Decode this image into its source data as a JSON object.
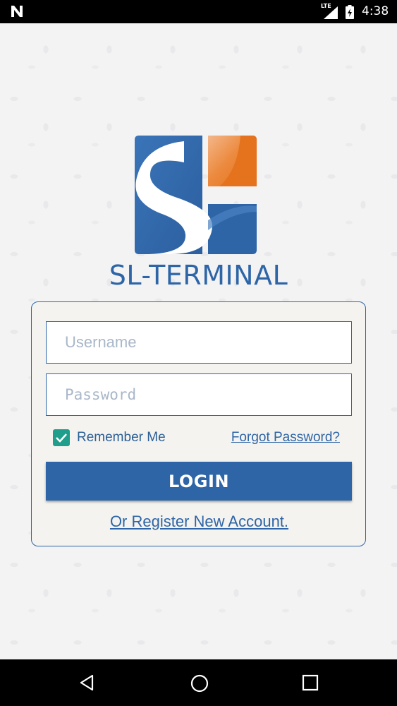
{
  "status_bar": {
    "time": "4:38",
    "network": "LTE",
    "icons": [
      "n-notification-icon",
      "signal-icon",
      "battery-icon"
    ]
  },
  "logo": {
    "brand_name": "SL-TERMINAL",
    "colors": {
      "blue": "#2d65a7",
      "orange": "#e8731f"
    }
  },
  "login_form": {
    "username_placeholder": "Username",
    "username_value": "",
    "password_placeholder": "Password",
    "password_value": "",
    "remember_me_label": "Remember Me",
    "remember_me_checked": true,
    "forgot_password_label": "Forgot Password?",
    "login_label": "LOGIN",
    "register_label": "Or Register New Account."
  },
  "nav_bar": {
    "icons": [
      "back-icon",
      "home-icon",
      "recents-icon"
    ]
  },
  "theme": {
    "primary": "#2d65a7",
    "checkbox": "#1f9e8c",
    "card_bg": "#f5f3ef"
  }
}
